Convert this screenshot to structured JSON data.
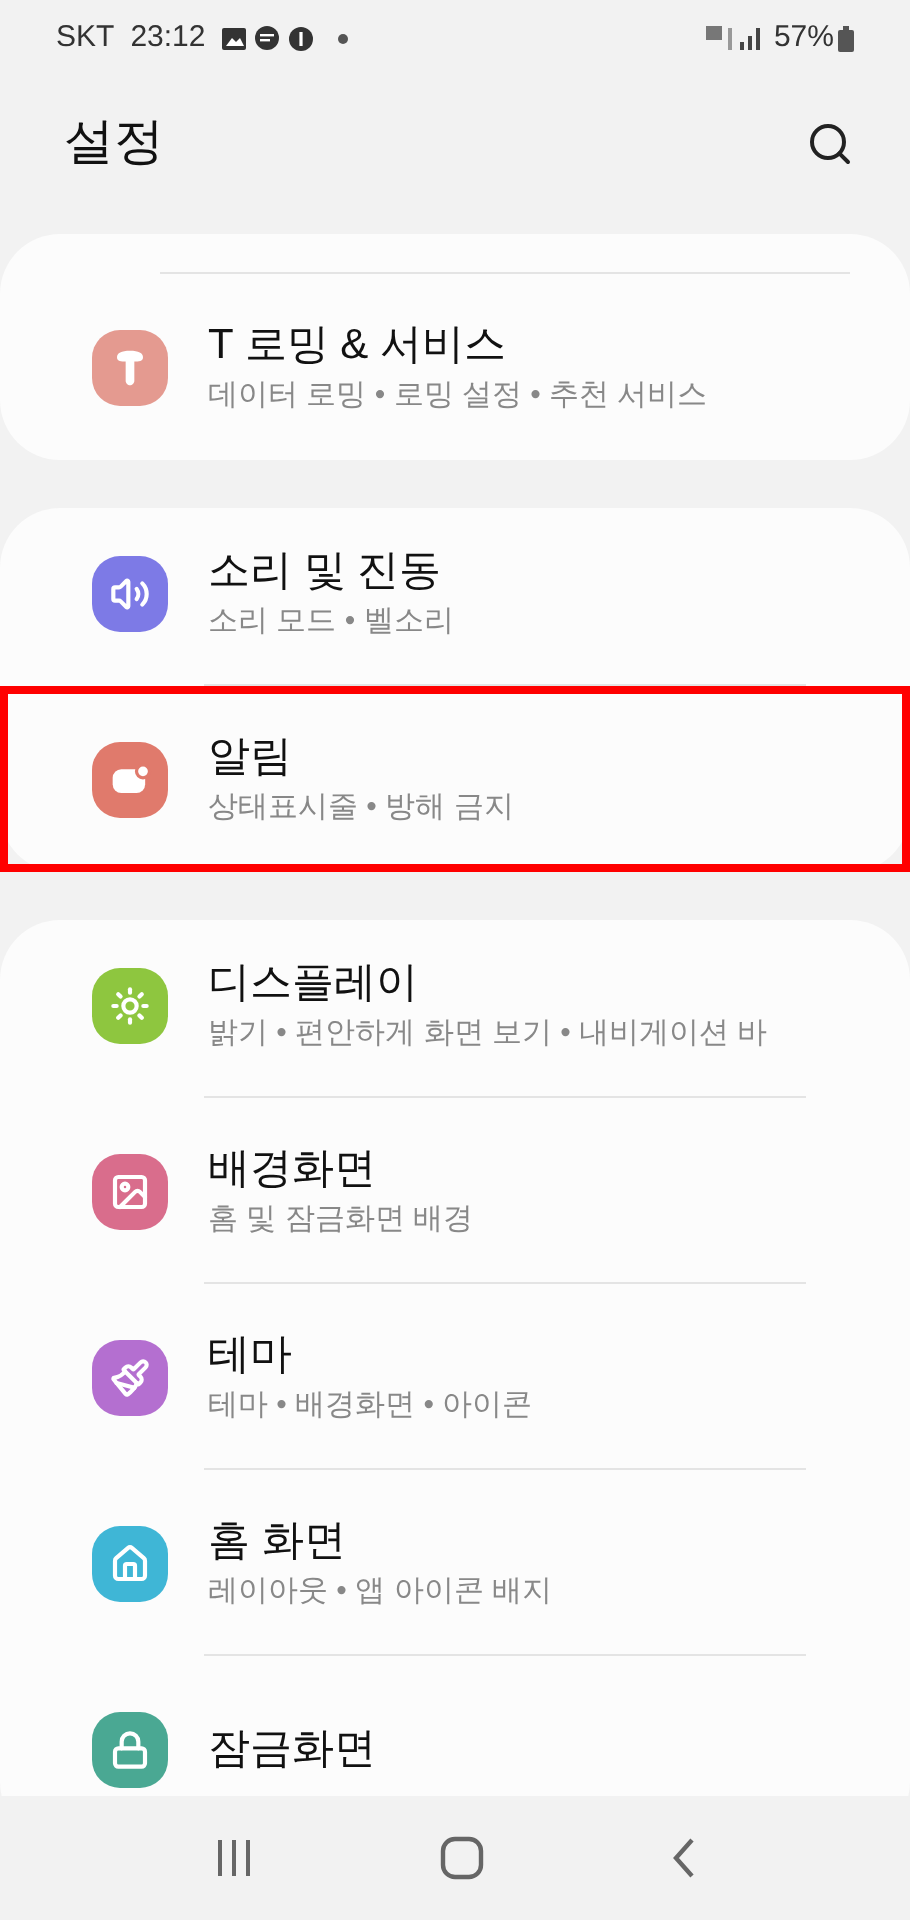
{
  "status_bar": {
    "carrier": "SKT",
    "time": "23:12",
    "battery": "57%"
  },
  "header": {
    "title": "설정"
  },
  "sections": [
    {
      "items": [
        {
          "title": "T 로밍 & 서비스",
          "subtitle": "데이터 로밍 • 로밍 설정 • 추천 서비스",
          "highlighted": false
        }
      ]
    },
    {
      "items": [
        {
          "title": "소리 및 진동",
          "subtitle": "소리 모드 • 벨소리",
          "highlighted": false
        },
        {
          "title": "알림",
          "subtitle": "상태표시줄 • 방해 금지",
          "highlighted": true
        }
      ]
    },
    {
      "items": [
        {
          "title": "디스플레이",
          "subtitle": "밝기 • 편안하게 화면 보기 • 내비게이션 바",
          "highlighted": false
        },
        {
          "title": "배경화면",
          "subtitle": "홈 및 잠금화면 배경",
          "highlighted": false
        },
        {
          "title": "테마",
          "subtitle": "테마 • 배경화면 • 아이콘",
          "highlighted": false
        },
        {
          "title": "홈 화면",
          "subtitle": "레이아웃 • 앱 아이콘 배지",
          "highlighted": false
        },
        {
          "title": "잠금화면",
          "highlighted": false
        }
      ]
    }
  ]
}
